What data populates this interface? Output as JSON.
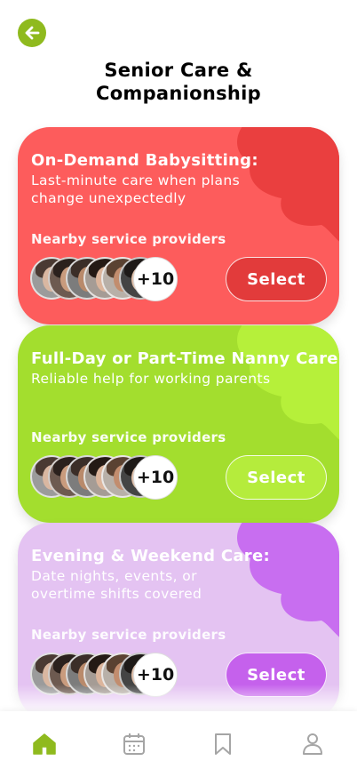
{
  "header": {
    "title": "Senior Care &\nCompanionship",
    "back_icon": "arrow-left-icon"
  },
  "colors": {
    "accent": "#8fba1e",
    "red_card": "#fd5c5c",
    "red_blob": "#ea3f3f",
    "red_button": "#e23b3b",
    "green_card": "#a3de2e",
    "green_blob": "#b6f03a",
    "purple_card": "#e4c3f2",
    "purple_blob": "#c86ef0",
    "purple_button": "#c561ec"
  },
  "cards": [
    {
      "title": "On-Demand Babysitting:",
      "description": "Last-minute care when plans change unexpectedly",
      "nearby_label": "Nearby service providers",
      "more_count": "+10",
      "select_label": "Select"
    },
    {
      "title": "Full-Day or Part-Time Nanny Care:",
      "description": "Reliable help for working parents",
      "nearby_label": "Nearby service providers",
      "more_count": "+10",
      "select_label": "Select"
    },
    {
      "title": "Evening & Weekend Care:",
      "description": "Date nights, events, or overtime shifts covered",
      "nearby_label": "Nearby service providers",
      "more_count": "+10",
      "select_label": "Select"
    }
  ],
  "tabbar": {
    "items": [
      {
        "icon": "home-icon",
        "active": true
      },
      {
        "icon": "calendar-icon",
        "active": false
      },
      {
        "icon": "bookmark-icon",
        "active": false
      },
      {
        "icon": "profile-icon",
        "active": false
      }
    ]
  }
}
